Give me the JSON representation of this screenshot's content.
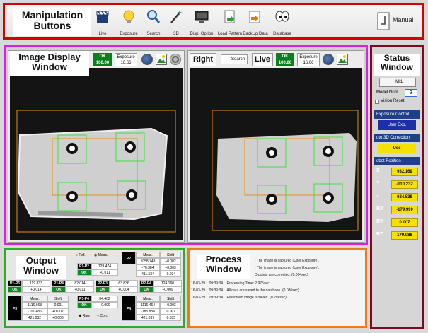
{
  "callouts": {
    "manipulation": "Manipulation Buttons",
    "display": "Image Display Window",
    "status": "Status Window",
    "output": "Output Window",
    "process": "Process Window"
  },
  "toolbar": {
    "buttons": [
      {
        "label": "Live",
        "icon": "clapperboard-icon"
      },
      {
        "label": "Exposure",
        "icon": "lightbulb-icon"
      },
      {
        "label": "Search",
        "icon": "magnifier-icon"
      },
      {
        "label": "3D",
        "icon": "magic-wand-icon"
      },
      {
        "label": "Disp. Option",
        "icon": "monitor-icon"
      },
      {
        "label": "Load Pattern",
        "icon": "document-arrow-icon"
      },
      {
        "label": "BackUp Data",
        "icon": "backup-icon"
      },
      {
        "label": "Database",
        "icon": "eyes-icon"
      }
    ],
    "manual_label": "Manual"
  },
  "display": {
    "left": {
      "ok_line1": "OK",
      "ok_line2": "100.00",
      "exposure_label": "Exposure",
      "exposure_value": "16.66"
    },
    "right": {
      "side_label": "Right",
      "search_label": "Search",
      "live_label": "Live",
      "ok_line1": "OK",
      "ok_line2": "100.00",
      "exposure_label": "Exposure",
      "exposure_value": "16.66"
    }
  },
  "status": {
    "hmi_label": "HMI1",
    "model_label": "Model Num",
    "model_value": "3",
    "vision_reset": "Vision Reset",
    "exposure_control_header": "Exposure Control",
    "user_exp_label": "User Exp.",
    "correction_header": "uto 3D Correction",
    "use_label": "Use",
    "robot_position_header": "obot Position",
    "positions": [
      {
        "axis": "X",
        "value": "932.169"
      },
      {
        "axis": "Y",
        "value": "-110.232"
      },
      {
        "axis": "Z",
        "value": "684.538"
      },
      {
        "axis": "RX",
        "value": "-179.990"
      },
      {
        "axis": "RY",
        "value": "0.007"
      },
      {
        "axis": "RZ",
        "value": "179.988"
      }
    ],
    "colors": {
      "section": "#1f3f8a",
      "value": "#f5e000"
    }
  },
  "output": {
    "radio_ref": "Ref.",
    "radio_meas": "Meas.",
    "radio_raw": "Raw",
    "radio_corr": "Corr.",
    "p1p2": {
      "label": "P1-P2",
      "value": "129.474",
      "ok": "OK",
      "diff": "+0.011"
    },
    "p1p3": {
      "label": "P1-P3",
      "value": "119.833",
      "ok": "OK",
      "diff": "+0.014"
    },
    "p1p4": {
      "label": "P1-P4",
      "value": "82.014",
      "ok": "OK",
      "diff": "+0.011"
    },
    "p2p3": {
      "label": "P2-P3",
      "value": "63.836",
      "ok": "OK",
      "diff": "+0.004"
    },
    "p2p4": {
      "label": "P2-P4",
      "value": "124.160",
      "ok": "OK",
      "diff": "+0.009"
    },
    "p3p4": {
      "label": "P3-P4",
      "value": "84.402",
      "ok": "OK",
      "diff": "+0.009"
    },
    "p2": {
      "label": "P2",
      "meas_head": "Meas.",
      "shift_head": "Shift",
      "meas": [
        "1058.743",
        "-76.384",
        "411.534"
      ],
      "shift": [
        "+0.002",
        "+0.003",
        "-0.034"
      ]
    },
    "p3": {
      "label": "P3",
      "meas_head": "Meas.",
      "shift_head": "Shift",
      "meas": [
        "1116.663",
        "-101.486",
        "421.032"
      ],
      "shift": [
        "-0.001",
        "+0.002",
        "+0.006"
      ]
    },
    "p4": {
      "label": "P4",
      "meas_head": "Meas.",
      "shift_head": "Shift",
      "meas": [
        "1116.464",
        "-185.888",
        "421.037"
      ],
      "shift": [
        "+0.003",
        "-0.007",
        "-0.035"
      ]
    },
    "section_label": "Output"
  },
  "process": {
    "section_label": "Process",
    "lines": [
      {
        "date": "",
        "time": "",
        "msg": "] The image is captured (User Exposure)."
      },
      {
        "date": "",
        "time": "",
        "msg": "] The image is captured (User Exposure)."
      },
      {
        "date": "",
        "time": "",
        "msg": "D points are corrected. (0.004sec)"
      },
      {
        "date": "16-03-29",
        "time": "09:39:34",
        "msg": "Processing Time: 2.975sec"
      },
      {
        "date": "16-03-29",
        "time": "09:39:34",
        "msg": "All data are saved to the database. (0.086sec)"
      },
      {
        "date": "16-03-29",
        "time": "09:39:34",
        "msg": "Fullscreen image is saved. (0.296sec)"
      }
    ]
  }
}
